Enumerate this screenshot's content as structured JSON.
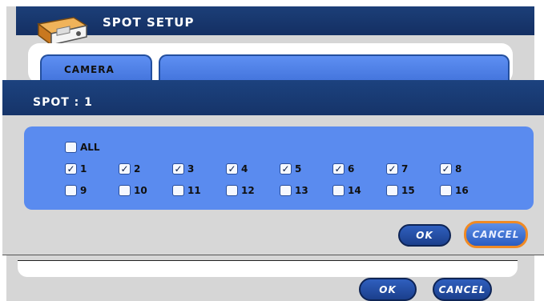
{
  "window": {
    "title": "SPOT SETUP"
  },
  "tabs": [
    {
      "label": "CAMERA"
    },
    {
      "label": ""
    }
  ],
  "dialog": {
    "title": "SPOT : 1",
    "all_checkbox": {
      "label": "ALL",
      "checked": false
    },
    "cameras": [
      {
        "label": "1",
        "checked": true
      },
      {
        "label": "2",
        "checked": true
      },
      {
        "label": "3",
        "checked": true
      },
      {
        "label": "4",
        "checked": true
      },
      {
        "label": "5",
        "checked": true
      },
      {
        "label": "6",
        "checked": true
      },
      {
        "label": "7",
        "checked": true
      },
      {
        "label": "8",
        "checked": true
      },
      {
        "label": "9",
        "checked": false
      },
      {
        "label": "10",
        "checked": false
      },
      {
        "label": "11",
        "checked": false
      },
      {
        "label": "12",
        "checked": false
      },
      {
        "label": "13",
        "checked": false
      },
      {
        "label": "14",
        "checked": false
      },
      {
        "label": "15",
        "checked": false
      },
      {
        "label": "16",
        "checked": false
      }
    ],
    "ok_label": "OK",
    "cancel_label": "CANCEL"
  },
  "footer": {
    "ok_label": "OK",
    "cancel_label": "CANCEL"
  },
  "colors": {
    "title_bar": "#1c3f78",
    "panel": "#5a8bef",
    "highlight": "#f08a24"
  }
}
